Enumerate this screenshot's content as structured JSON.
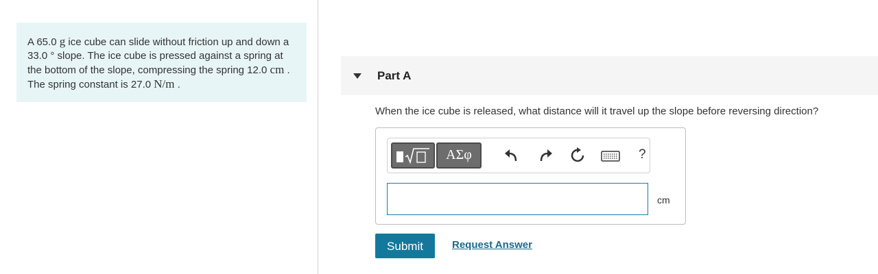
{
  "problem": {
    "t1": "A 65.0 ",
    "m1": "g",
    "t2": " ice cube can slide without friction up and down a 33.0 ° slope. The ice cube is pressed against a spring at the bottom of the slope, compressing the spring 12.0 ",
    "m2": "cm",
    "t3": " . The spring constant is 27.0 ",
    "m3": "N/m",
    "t4": " ."
  },
  "part": {
    "title": "Part A",
    "question": "When the ice cube is released, what distance will it travel up the slope before reversing direction?"
  },
  "toolbar": {
    "greek_label": "ΑΣφ",
    "help_label": "?"
  },
  "answer": {
    "value": "",
    "unit": "cm"
  },
  "actions": {
    "submit_label": "Submit",
    "request_label": "Request Answer"
  }
}
